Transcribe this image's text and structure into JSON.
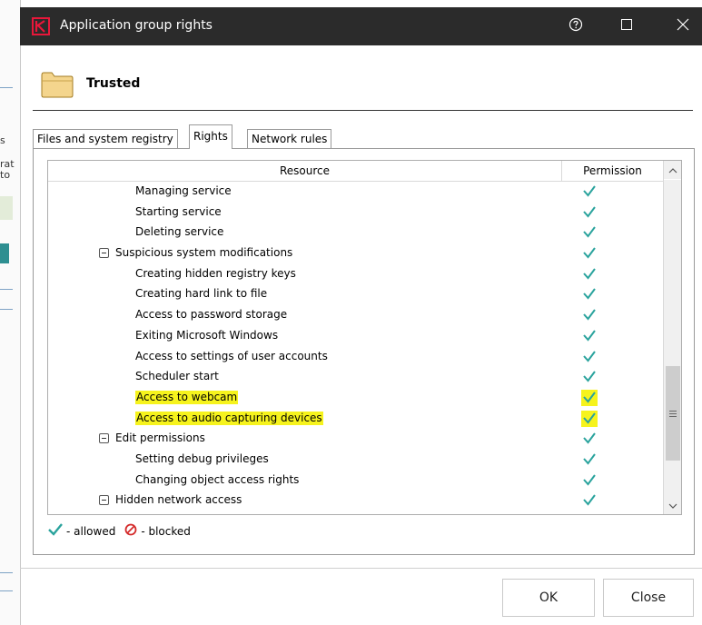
{
  "window": {
    "title": "Application group rights",
    "controls": [
      "help-icon",
      "maximize-icon",
      "close-icon"
    ]
  },
  "background_fragments": [
    "s",
    "rat",
    "to"
  ],
  "header": {
    "group_name": "Trusted",
    "icon": "folder-icon"
  },
  "tabs": [
    {
      "label": "Files and system registry",
      "active": false
    },
    {
      "label": "Rights",
      "active": true
    },
    {
      "label": "Network rules",
      "active": false
    }
  ],
  "grid": {
    "columns": {
      "resource": "Resource",
      "permission": "Permission"
    },
    "rows": [
      {
        "label": "Managing service",
        "level": 2,
        "permission": "allowed",
        "highlighted": false
      },
      {
        "label": "Starting service",
        "level": 2,
        "permission": "allowed",
        "highlighted": false
      },
      {
        "label": "Deleting service",
        "level": 2,
        "permission": "allowed",
        "highlighted": false
      },
      {
        "label": "Suspicious system modifications",
        "level": 1,
        "group": true,
        "permission": "allowed",
        "highlighted": false
      },
      {
        "label": "Creating hidden registry keys",
        "level": 2,
        "permission": "allowed",
        "highlighted": false
      },
      {
        "label": "Creating hard link to file",
        "level": 2,
        "permission": "allowed",
        "highlighted": false
      },
      {
        "label": "Access to password storage",
        "level": 2,
        "permission": "allowed",
        "highlighted": false
      },
      {
        "label": "Exiting Microsoft Windows",
        "level": 2,
        "permission": "allowed",
        "highlighted": false
      },
      {
        "label": "Access to settings of user accounts",
        "level": 2,
        "permission": "allowed",
        "highlighted": false
      },
      {
        "label": "Scheduler start",
        "level": 2,
        "permission": "allowed",
        "highlighted": false
      },
      {
        "label": "Access to webcam",
        "level": 2,
        "permission": "allowed",
        "highlighted": true
      },
      {
        "label": "Access to audio capturing devices",
        "level": 2,
        "permission": "allowed",
        "highlighted": true
      },
      {
        "label": "Edit permissions",
        "level": 1,
        "group": true,
        "permission": "allowed",
        "highlighted": false
      },
      {
        "label": "Setting debug privileges",
        "level": 2,
        "permission": "allowed",
        "highlighted": false
      },
      {
        "label": "Changing object access rights",
        "level": 2,
        "permission": "allowed",
        "highlighted": false
      },
      {
        "label": "Hidden network access",
        "level": 1,
        "group": true,
        "permission": "allowed",
        "highlighted": false
      }
    ]
  },
  "legend": {
    "allowed": "- allowed",
    "blocked": "- blocked"
  },
  "footer": {
    "ok_label": "OK",
    "close_label": "Close"
  },
  "colors": {
    "titlebar": "#2b2b2b",
    "check": "#2aa39d",
    "blocked": "#d42a2a",
    "highlight": "#f6f31d",
    "brand": "#e8173a"
  }
}
